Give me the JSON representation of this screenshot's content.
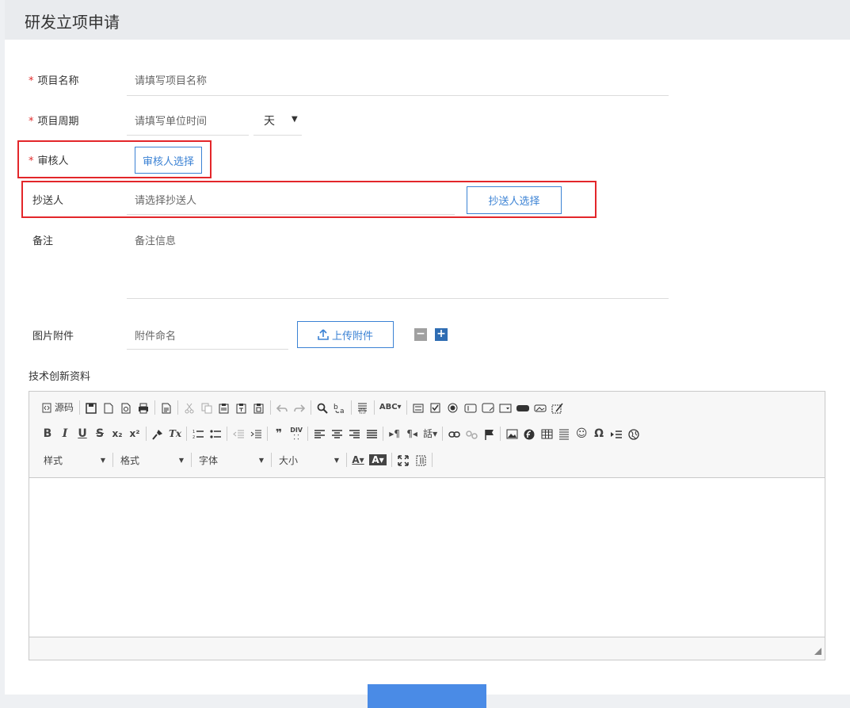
{
  "page": {
    "title": "研发立项申请"
  },
  "form": {
    "project_name": {
      "label": "项目名称",
      "required_mark": "*",
      "placeholder": "请填写项目名称"
    },
    "project_period": {
      "label": "项目周期",
      "required_mark": "*",
      "placeholder": "请填写单位时间",
      "unit_selected": "天"
    },
    "reviewer": {
      "label": "审核人",
      "required_mark": "*",
      "button": "审核人选择"
    },
    "cc": {
      "label": "抄送人",
      "placeholder": "请选择抄送人",
      "button": "抄送人选择"
    },
    "remark": {
      "label": "备注",
      "placeholder": "备注信息"
    },
    "attachment": {
      "label": "图片附件",
      "placeholder": "附件命名",
      "upload_button": "上传附件",
      "minus": "−",
      "plus": "+"
    },
    "tech_label": "技术创新资料"
  },
  "editor": {
    "source_label": "源码",
    "combos": {
      "style": "样式",
      "format": "格式",
      "font": "字体",
      "size": "大小"
    },
    "glyphs": {
      "bold": "B",
      "italic": "I",
      "underline": "U",
      "strike": "S",
      "subscript": "x₂",
      "superscript": "x²",
      "clear_format": "Tx",
      "quote": "❞",
      "ltr": "▸¶",
      "rtl": "¶◂",
      "language": "話▾",
      "omega": "Ω",
      "smiley": "☺",
      "text_color": "A▾",
      "bg_color": "A▾"
    }
  },
  "colors": {
    "accent": "#3b82d4",
    "required": "#e02b2b",
    "highlight_box": "#e3262a",
    "minus_bg": "#a0a0a0",
    "plus_bg": "#2f6db3",
    "submit_bg": "#4a8be6"
  }
}
